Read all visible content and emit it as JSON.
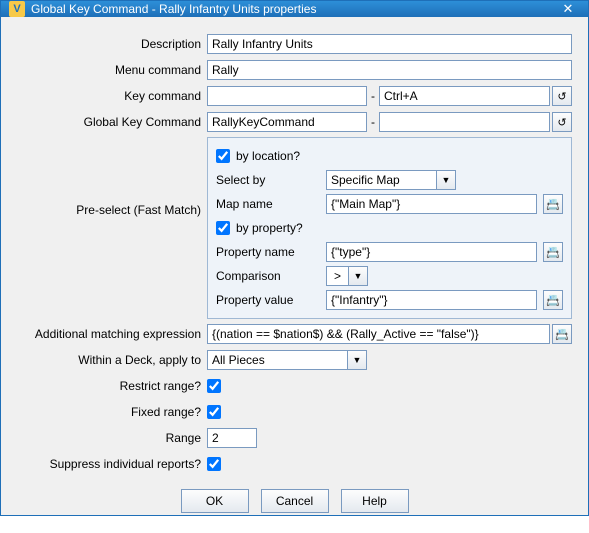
{
  "window": {
    "title": "Global Key Command - Rally Infantry Units properties"
  },
  "labels": {
    "description": "Description",
    "menu_command": "Menu command",
    "key_command": "Key command",
    "global_key_command": "Global Key Command",
    "preselect": "Pre-select (Fast Match)",
    "additional": "Additional matching expression",
    "within_deck": "Within a Deck, apply to",
    "restrict_range": "Restrict range?",
    "fixed_range": "Fixed range?",
    "range": "Range",
    "suppress": "Suppress individual reports?"
  },
  "panel_labels": {
    "by_location": "by location?",
    "select_by": "Select by",
    "map_name": "Map name",
    "by_property": "by property?",
    "property_name": "Property name",
    "comparison": "Comparison",
    "property_value": "Property value"
  },
  "values": {
    "description": "Rally Infantry Units",
    "menu_command": "Rally",
    "key_command_left": "",
    "key_command_right": "Ctrl+A",
    "global_left": "RallyKeyCommand",
    "global_right": "",
    "by_location_checked": true,
    "select_by": "Specific Map",
    "map_name": "{\"Main Map\"}",
    "by_property_checked": true,
    "property_name": "{\"type\"}",
    "comparison": ">",
    "property_value": "{\"Infantry\"}",
    "additional": "{(nation == $nation$) && (Rally_Active == \"false\")}",
    "within_deck": "All Pieces",
    "restrict_range_checked": true,
    "fixed_range_checked": true,
    "range": "2",
    "suppress_checked": true
  },
  "buttons": {
    "ok": "OK",
    "cancel": "Cancel",
    "help": "Help"
  },
  "icons": {
    "calc": "📇",
    "undo": "↺",
    "dropdown": "▼",
    "close": "✕",
    "app": "V"
  },
  "sep": "-"
}
